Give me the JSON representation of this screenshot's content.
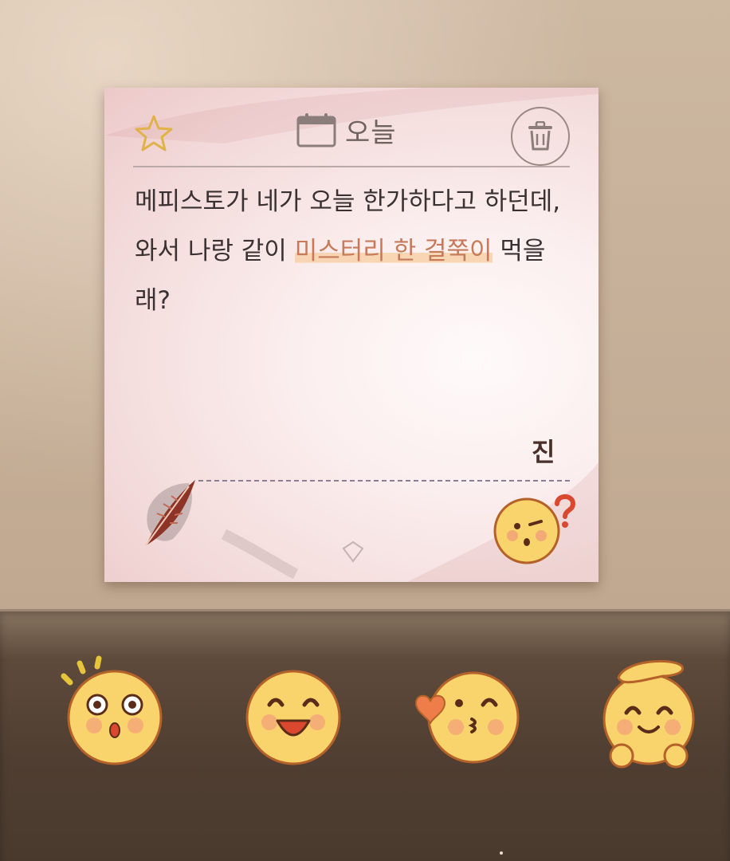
{
  "note": {
    "header_title": "오늘",
    "message_part1": "메피스토가 네가 오늘 한가하다고 하던데, 와서 나랑 같이 ",
    "message_highlight": "미스터리 한 걸쭉이",
    "message_part2": " 먹을래?",
    "signature": "진"
  },
  "icons": {
    "favorite": "star-icon",
    "date": "calendar-icon",
    "delete": "trash-icon",
    "decoration": "quill-icon",
    "reply_sticker": "confused-emoji"
  },
  "reactions": [
    {
      "name": "surprised-emoji"
    },
    {
      "name": "laughing-emoji"
    },
    {
      "name": "kiss-heart-emoji"
    },
    {
      "name": "head-pat-emoji"
    }
  ],
  "colors": {
    "highlight_text": "#c67a5a",
    "highlight_marker": "#f6cda0",
    "body_text": "#3a3232",
    "signature": "#4a2e2a",
    "emoji_face": "#f9d36b",
    "emoji_outline": "#b5622a"
  }
}
